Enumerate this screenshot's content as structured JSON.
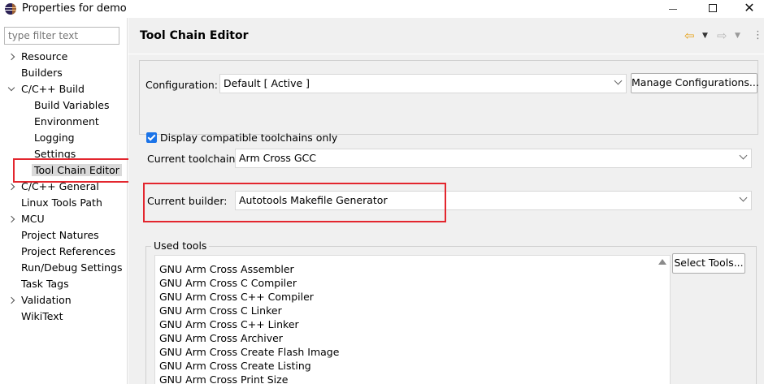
{
  "window": {
    "title": "Properties for demo",
    "minimize_label": "",
    "maximize_label": "",
    "close_label": "✕"
  },
  "filter": {
    "placeholder": "type filter text"
  },
  "tree": {
    "items": [
      {
        "label": "Resource",
        "twisty": "closed",
        "indent": 0
      },
      {
        "label": "Builders",
        "twisty": "none",
        "indent": 0
      },
      {
        "label": "C/C++ Build",
        "twisty": "open",
        "indent": 0
      },
      {
        "label": "Build Variables",
        "twisty": "none",
        "indent": 1
      },
      {
        "label": "Environment",
        "twisty": "none",
        "indent": 1
      },
      {
        "label": "Logging",
        "twisty": "none",
        "indent": 1
      },
      {
        "label": "Settings",
        "twisty": "none",
        "indent": 1
      },
      {
        "label": "Tool Chain Editor",
        "twisty": "none",
        "indent": 1,
        "selected": true
      },
      {
        "label": "C/C++ General",
        "twisty": "closed",
        "indent": 0
      },
      {
        "label": "Linux Tools Path",
        "twisty": "none",
        "indent": 0
      },
      {
        "label": "MCU",
        "twisty": "closed",
        "indent": 0
      },
      {
        "label": "Project Natures",
        "twisty": "none",
        "indent": 0
      },
      {
        "label": "Project References",
        "twisty": "none",
        "indent": 0
      },
      {
        "label": "Run/Debug Settings",
        "twisty": "none",
        "indent": 0
      },
      {
        "label": "Task Tags",
        "twisty": "none",
        "indent": 0
      },
      {
        "label": "Validation",
        "twisty": "closed",
        "indent": 0
      },
      {
        "label": "WikiText",
        "twisty": "none",
        "indent": 0
      }
    ]
  },
  "page": {
    "title": "Tool Chain Editor",
    "nav": {
      "back_icon": "⇦",
      "forward_icon": "⇨",
      "dropdown_icon": "▼",
      "menu_icon": "⋮"
    }
  },
  "configuration": {
    "label": "Configuration:",
    "value": "Default  [ Active ]",
    "manage_button": "Manage Configurations..."
  },
  "toolchain": {
    "display_compatible_label": "Display compatible toolchains only",
    "display_compatible_checked": true,
    "current_label": "Current toolchain:",
    "current_value": "Arm Cross GCC"
  },
  "builder": {
    "label": "Current builder:",
    "value": "Autotools Makefile Generator"
  },
  "used_tools": {
    "legend": "Used tools",
    "items": [
      "GNU Arm Cross Assembler",
      "GNU Arm Cross C Compiler",
      "GNU Arm Cross C++ Compiler",
      "GNU Arm Cross C Linker",
      "GNU Arm Cross C++ Linker",
      "GNU Arm Cross Archiver",
      "GNU Arm Cross Create Flash Image",
      "GNU Arm Cross Create Listing",
      "GNU Arm Cross Print Size"
    ],
    "select_button": "Select Tools..."
  },
  "colors": {
    "highlight_box": "#e3262e",
    "checkbox": "#1a73e8",
    "back_arrow": "#e6a21a"
  }
}
